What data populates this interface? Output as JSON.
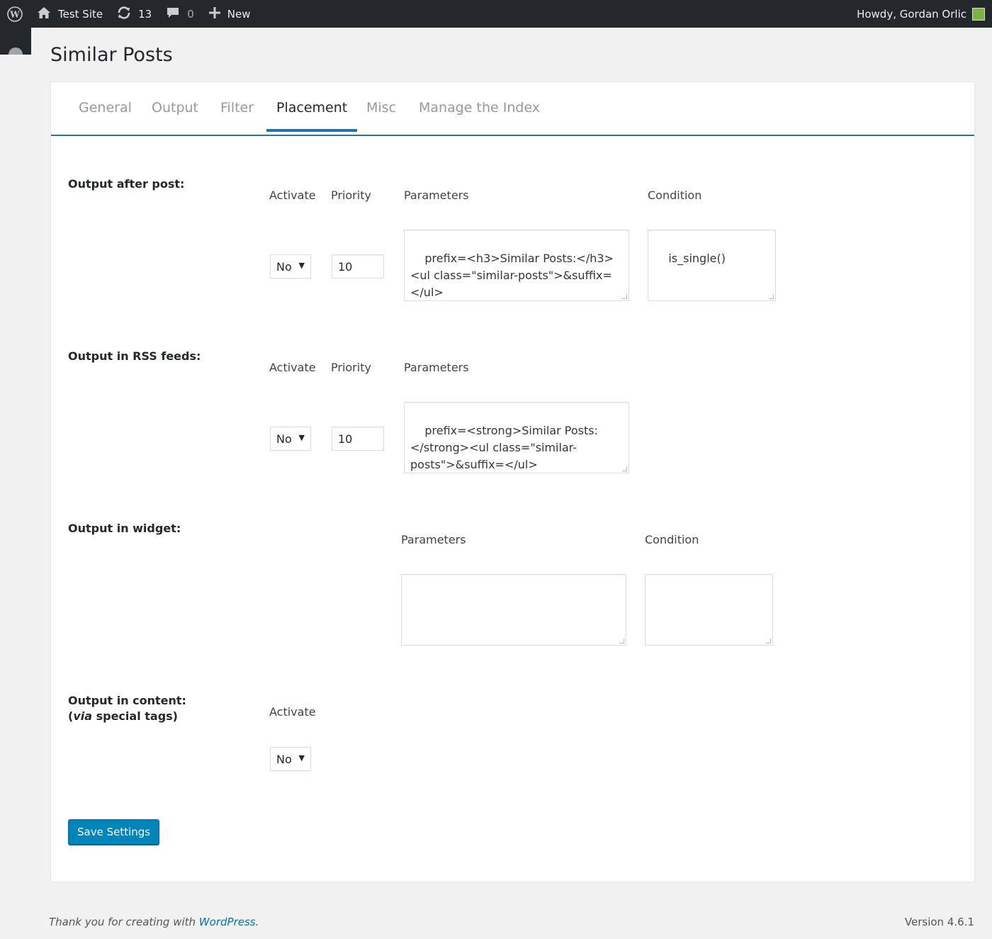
{
  "admin_bar": {
    "site_name": "Test Site",
    "updates_count": "13",
    "comments_count": "0",
    "new_label": "New",
    "greeting": "Howdy, Gordan Orlic"
  },
  "page": {
    "title": "Similar Posts"
  },
  "tabs": [
    "General",
    "Output",
    "Filter",
    "Placement",
    "Misc",
    "Manage the Index"
  ],
  "active_tab": "Placement",
  "headers": {
    "activate": "Activate",
    "priority": "Priority",
    "parameters": "Parameters",
    "condition": "Condition"
  },
  "sections": {
    "after_post": {
      "label": "Output after post:",
      "activate": "No",
      "priority": "10",
      "parameters": "prefix=<h3>Similar Posts:</h3><ul class=\"similar-posts\">&suffix=</ul>",
      "condition": "is_single()"
    },
    "rss": {
      "label": "Output in RSS feeds:",
      "activate": "No",
      "priority": "10",
      "parameters": "prefix=<strong>Similar Posts:</strong><ul class=\"similar-posts\">&suffix=</ul>"
    },
    "widget": {
      "label": "Output in widget:",
      "parameters": "",
      "condition": ""
    },
    "content": {
      "label": "Output in content:",
      "sublabel_prefix": "(",
      "sublabel_em": "via",
      "sublabel_rest": " special tags)",
      "activate": "No"
    }
  },
  "save_button": "Save Settings",
  "footer": {
    "thanks": "Thank you for creating with ",
    "link": "WordPress",
    "period": ".",
    "version": "Version 4.6.1"
  },
  "colors": {
    "admin_bar": "#23282d",
    "accent": "#2271b1",
    "button": "#0085ba",
    "link": "#0073aa"
  }
}
